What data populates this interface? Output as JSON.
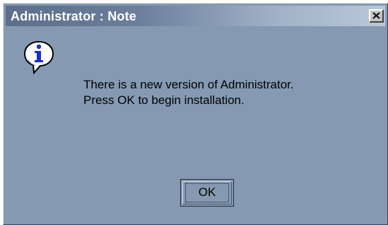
{
  "window": {
    "title": "Administrator : Note",
    "close_icon": "close-x-icon"
  },
  "content": {
    "icon": "information-icon",
    "message_lines": [
      "There is a new version of Administrator.",
      "Press OK to begin installation."
    ]
  },
  "buttons": {
    "ok_label": "OK"
  },
  "colors": {
    "dialog_background": "#8599b2",
    "title_gradient_start": "#5b6f8c",
    "title_gradient_end": "#b9c8d9",
    "title_text": "#ffffff",
    "info_icon_fill": "#1a2fd0"
  }
}
